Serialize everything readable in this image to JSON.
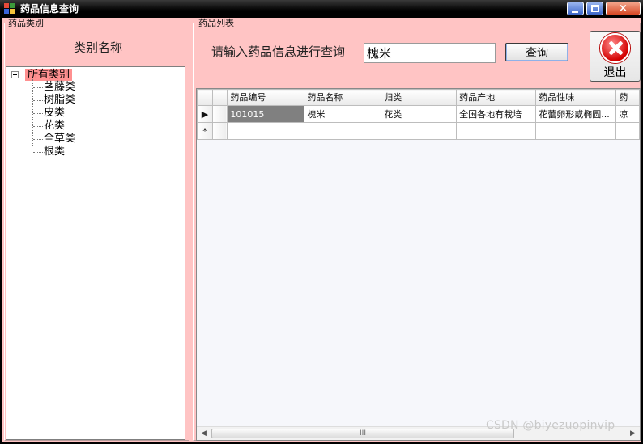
{
  "window": {
    "title": "药品信息查询",
    "controls": {
      "minimize": "minimize",
      "maximize": "maximize",
      "close": "×"
    }
  },
  "left_panel": {
    "group_title": "药品类别",
    "header": "类别名称",
    "tree": {
      "root": "所有类别",
      "children": [
        "茎藤类",
        "树脂类",
        "皮类",
        "花类",
        "全草类",
        "根类"
      ]
    }
  },
  "right_panel": {
    "group_title": "药品列表",
    "search_label": "请输入药品信息进行查询",
    "search_value": "槐米",
    "query_button": "查询",
    "exit_button": "退出"
  },
  "grid": {
    "columns": [
      "药品编号",
      "药品名称",
      "归类",
      "药品产地",
      "药品性味",
      "药"
    ],
    "rows": [
      {
        "indicator": "▶",
        "cells": [
          "101015",
          "槐米",
          "花类",
          "全国各地有栽培",
          "花蕾卵形或椭圆...",
          "凉"
        ]
      }
    ],
    "new_row_indicator": "*",
    "scrollbar_grip": "III"
  },
  "watermark": "CSDN @biyezuopinvip",
  "colors": {
    "panel_bg": "#ffc4c4",
    "tree_selection": "#ff9090",
    "selected_cell": "#808080",
    "title_bar": "#000000"
  }
}
